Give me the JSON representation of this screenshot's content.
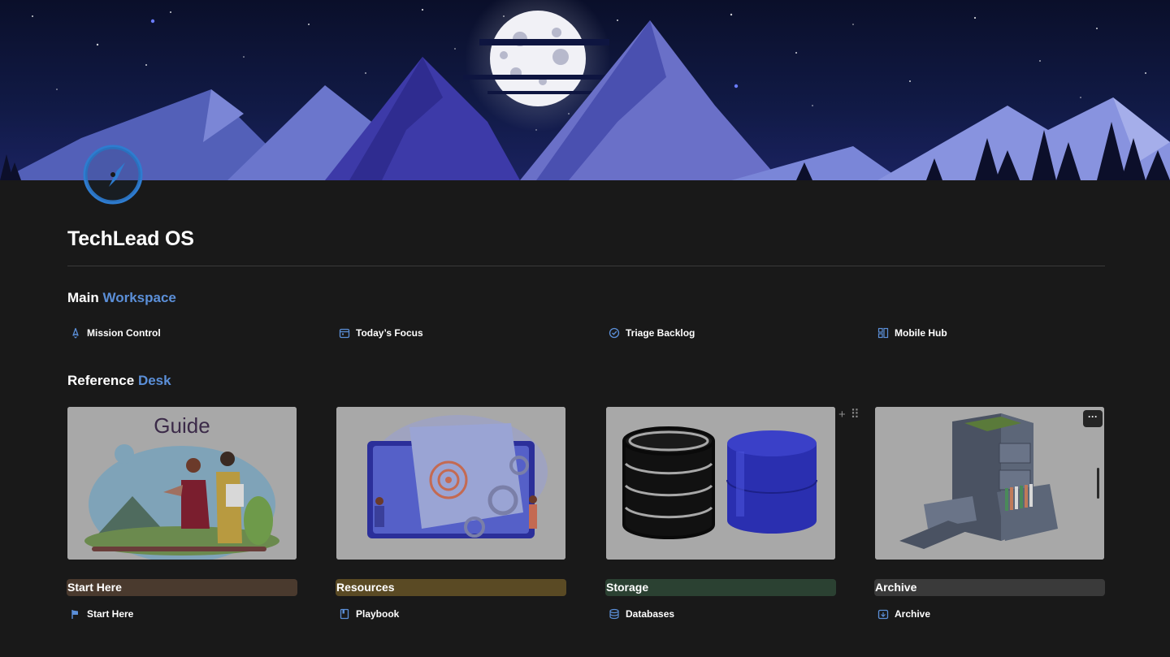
{
  "page": {
    "title": "TechLead OS",
    "icon": "compass-icon",
    "cover": "night-mountains-moon-cover"
  },
  "colors": {
    "background": "#191919",
    "accent": "#5b8fd8",
    "tag_start_here": "#4a3a2e",
    "tag_resources": "#5a4a24",
    "tag_storage": "#2b4132",
    "tag_archive": "#3a3a3a"
  },
  "main_workspace": {
    "heading_main": "Main",
    "heading_accent": "Workspace",
    "links": [
      {
        "label": "Mission Control",
        "icon": "rocket-icon"
      },
      {
        "label": "Today’s Focus",
        "icon": "calendar-icon"
      },
      {
        "label": "Triage Backlog",
        "icon": "check-circle-icon"
      },
      {
        "label": "Mobile Hub",
        "icon": "dashboard-icon"
      }
    ]
  },
  "reference_desk": {
    "heading_main": "Reference",
    "heading_accent": "Desk",
    "cards": [
      {
        "image": "guide-illustration",
        "image_text": "Guide",
        "tag": "Start Here",
        "link": "Start Here",
        "link_icon": "flag-icon"
      },
      {
        "image": "target-document-illustration",
        "tag": "Resources",
        "link": "Playbook",
        "link_icon": "book-icon"
      },
      {
        "image": "database-cylinders-illustration",
        "tag": "Storage",
        "link": "Databases",
        "link_icon": "database-icon"
      },
      {
        "image": "file-cabinet-illustration",
        "tag": "Archive",
        "link": "Archive",
        "link_icon": "archive-icon"
      }
    ],
    "card_tools": {
      "add": "+",
      "drag": "⠿",
      "more": "···"
    }
  }
}
